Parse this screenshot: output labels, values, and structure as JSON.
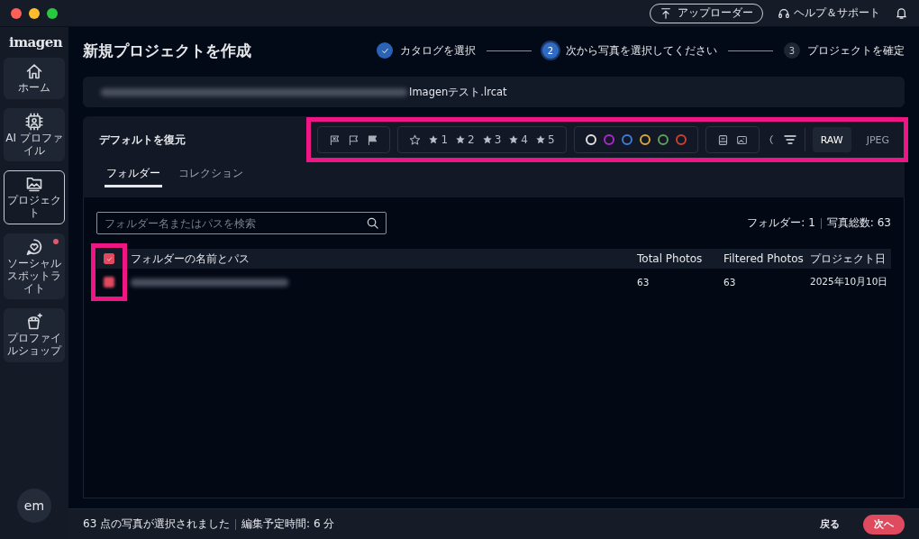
{
  "top_bar": {
    "uploader_button": "アップローダー",
    "help_link": "ヘルプ＆サポート"
  },
  "sidebar": {
    "logo": "imagen",
    "items": [
      {
        "kind": "home",
        "label": "ホーム",
        "selected": false,
        "badge": false
      },
      {
        "kind": "ai",
        "label": "AI プロファイル",
        "selected": false,
        "badge": false
      },
      {
        "kind": "project",
        "label": "プロジェクト",
        "selected": true,
        "badge": false
      },
      {
        "kind": "social",
        "label": "ソーシャルスポットライト",
        "selected": false,
        "badge": true
      },
      {
        "kind": "shop",
        "label": "プロファイルショップ",
        "selected": false,
        "badge": false
      }
    ],
    "avatar": "em"
  },
  "header": {
    "title": "新規プロジェクトを作成",
    "steps": [
      {
        "label": "カタログを選択",
        "completed": true,
        "selected": false
      },
      {
        "label": "次から写真を選択してください",
        "number": "2",
        "completed": false,
        "selected": true
      },
      {
        "label": "プロジェクトを確定",
        "number": "3",
        "completed": false,
        "selected": false
      }
    ]
  },
  "catalog_path": {
    "file": "Imagenテスト.lrcat"
  },
  "filters": {
    "reset_label": "デフォルトを復元",
    "highlighted": true,
    "stars": [
      "1",
      "2",
      "3",
      "4",
      "5"
    ],
    "colors": [
      {
        "color": "#e0e0e0"
      },
      {
        "color": "#b026c9"
      },
      {
        "color": "#3d7bd8"
      },
      {
        "color": "#d8a93a"
      },
      {
        "color": "#5fa05a"
      },
      {
        "color": "#c9412f"
      }
    ],
    "formats": [
      {
        "label": "RAW",
        "selected": true
      },
      {
        "label": "JPEG",
        "selected": false
      }
    ]
  },
  "tabs": [
    {
      "label": "フォルダー",
      "selected": true
    },
    {
      "label": "コレクション",
      "selected": false
    }
  ],
  "search": {
    "placeholder": "フォルダー名またはパスを検索"
  },
  "counts": {
    "folders": "フォルダー: 1",
    "photos": "写真総数: 63"
  },
  "table": {
    "checkbox_column_highlighted": true,
    "all_checked": true,
    "columns": [
      "フォルダーの名前とパス",
      "Total Photos",
      "Filtered Photos",
      "プロジェクト日"
    ],
    "rows": [
      {
        "checked": true,
        "total": "63",
        "filtered": "63",
        "date": "2025年10月10日"
      }
    ]
  },
  "footer": {
    "selected_text": "63 点の写真が選択されました",
    "time_text": "編集予定時間: 6 分",
    "back_button": "戻る",
    "next_button": "次へ"
  }
}
